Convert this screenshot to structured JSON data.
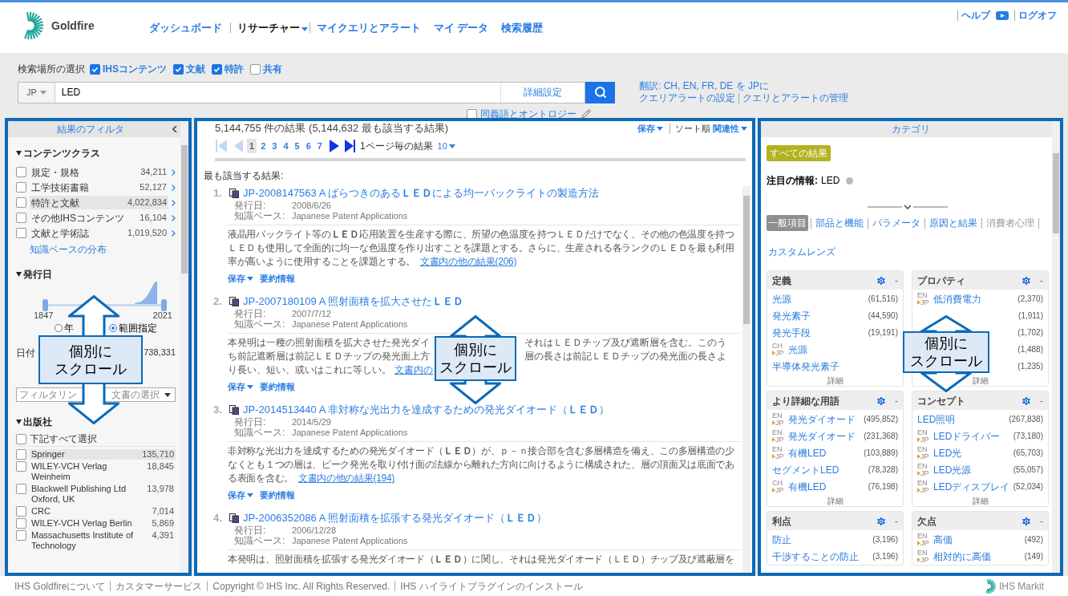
{
  "header": {
    "logo_text": "Goldfire",
    "nav": [
      {
        "label": "ダッシュボード",
        "selected": false,
        "menu": false
      },
      {
        "label": "リサーチャー",
        "selected": true,
        "menu": true
      },
      {
        "label": "マイクエリとアラート",
        "selected": false,
        "menu": false
      },
      {
        "label": "マイ データ",
        "selected": false,
        "menu": false
      },
      {
        "label": "検索履歴",
        "selected": false,
        "menu": false
      }
    ],
    "help": "ヘルプ",
    "logoff": "ログオフ"
  },
  "search": {
    "scope_label": "検索場所の選択",
    "scopes": [
      {
        "label": "IHSコンテンツ",
        "checked": true
      },
      {
        "label": "文献",
        "checked": true
      },
      {
        "label": "特許",
        "checked": true
      },
      {
        "label": "共有",
        "checked": false
      }
    ],
    "lang": "JP",
    "value": "LED",
    "advanced": "詳細設定",
    "synonyms": {
      "label": "同義語とオントロジー",
      "checked": false
    },
    "translate": "翻訳: CH, EN, FR, DE を JPに",
    "alert_setup": "クエリアラートの設定",
    "alert_manage": "クエリとアラートの管理"
  },
  "filters": {
    "title": "結果のフィルタ",
    "content_class": {
      "title": "コンテンツクラス",
      "items": [
        {
          "label": "規定・規格",
          "count": "34,211",
          "checked": false,
          "highlighted": false
        },
        {
          "label": "工学技術書籍",
          "count": "52,127",
          "checked": false,
          "highlighted": false
        },
        {
          "label": "特許と文献",
          "count": "4,022,834",
          "checked": false,
          "highlighted": true
        },
        {
          "label": "その他IHSコンテンツ",
          "count": "16,104",
          "checked": false,
          "highlighted": false
        },
        {
          "label": "文献と学術誌",
          "count": "1,019,520",
          "checked": false,
          "highlighted": false
        }
      ],
      "link": "知識ベースの分布"
    },
    "date": {
      "title": "発行日",
      "start": "1847",
      "end": "2021",
      "radios": [
        {
          "label": "年",
          "selected": false
        },
        {
          "label": "範囲指定",
          "selected": true
        }
      ],
      "date_label": "日付",
      "date_count": "738,331",
      "select_start": "フィルタリン",
      "select_end": "文書の選択"
    },
    "publishers": {
      "title": "出版社",
      "select_all": {
        "label": "下記すべて選択",
        "checked": false
      },
      "items": [
        {
          "label": "Springer",
          "count": "135,710",
          "checked": false,
          "highlighted": true
        },
        {
          "label": "WILEY-VCH Verlag Weinheim",
          "count": "18,845",
          "checked": false,
          "highlighted": false
        },
        {
          "label": "Blackwell Publishing Ltd Oxford, UK",
          "count": "13,978",
          "checked": false,
          "highlighted": false
        },
        {
          "label": "CRC",
          "count": "7,014",
          "checked": false,
          "highlighted": false
        },
        {
          "label": "WILEY-VCH Verlag Berlin",
          "count": "5,869",
          "checked": false,
          "highlighted": false
        },
        {
          "label": "Massachusetts Institute of Technology",
          "count": "4,391",
          "checked": false,
          "highlighted": false
        }
      ]
    }
  },
  "results": {
    "summary": "5,144,755 件の結果 (5,144,632 最も該当する結果)",
    "save": "保存",
    "sort_label": "ソート順",
    "sort_value": "関連性",
    "pages": [
      {
        "label": "1",
        "selected": true
      },
      {
        "label": "2",
        "selected": false
      },
      {
        "label": "3",
        "selected": false
      },
      {
        "label": "4",
        "selected": false
      },
      {
        "label": "5",
        "selected": false
      },
      {
        "label": "6",
        "selected": false
      },
      {
        "label": "7",
        "selected": false
      }
    ],
    "per_page_label": "1ページ毎の結果",
    "per_page": "10",
    "section": "最も該当する結果:",
    "items": [
      {
        "kind": "full",
        "num": "1.",
        "title": "JP-2008147563 A ばらつきのある**ＬＥＤ**による均一バックライトの製造方法",
        "date_label": "発行日:",
        "date": "2008/6/26",
        "kb_label": "知識ベース:",
        "kb": "Japanese Patent Applications",
        "abstract": "液晶用バックライト等の**ＬＥＤ**応用装置を生産する際に、所望の色温度を持つＬＥＤだけでなく、その他の色温度を持つＬＥＤも使用して全面的に均一な色温度を作り出すことを課題とする。さらに、生産される各ランクのＬＥＤを最も利用率が高いように使用することを課題とする。",
        "more": "文書内の他の結果(206)",
        "actions": [
          "保存",
          "要約情報"
        ]
      },
      {
        "kind": "split",
        "num": "2.",
        "title": "JP-2007180109 A 照射面積を拡大させた**ＬＥＤ**",
        "date_label": "発行日:",
        "date": "2007/7/12",
        "kb_label": "知識ベース:",
        "kb": "Japanese Patent Applications",
        "abstract_lines": [
          [
            "本発明は一種の照射面積を拡大させた発光ダイ",
            "それはＬＥＤチップ及び遮断層を含む。このう"
          ],
          [
            "ち前記遮断層は前記ＬＥＤチップの発光面上方",
            "層の長さは前記ＬＥＤチップの発光面の長さよ"
          ],
          [
            "り長い、短い、或いはこれに等しい。"
          ]
        ],
        "more": "文書内の",
        "actions": [
          "保存",
          "要約情報"
        ]
      },
      {
        "kind": "full",
        "num": "3.",
        "title": "JP-2014513440 A 非対称な光出力を達成するための発光ダイオード（**ＬＥＤ**）",
        "date_label": "発行日:",
        "date": "2014/5/29",
        "kb_label": "知識ベース:",
        "kb": "Japanese Patent Applications",
        "abstract": "非対称な光出力を達成するための発光ダイオード（**ＬＥＤ**）が、ｐ－ｎ接合部を含む多層構造を備え、この多層構造の少なくとも１つの層は、ピーク発光を取り付け面の法線から離れた方向に向けるように構成された、層の頂面又は底面である表面を含む。",
        "more": "文書内の他の結果(194)",
        "actions": [
          "保存",
          "要約情報"
        ]
      },
      {
        "kind": "full",
        "num": "4.",
        "title": "JP-2006352086 A 照射面積を拡張する発光ダイオード（**ＬＥＤ**）",
        "date_label": "発行日:",
        "date": "2006/12/28",
        "kb_label": "知識ベース:",
        "kb": "Japanese Patent Applications",
        "abstract": "本発明は、照射面積を拡張する発光ダイオード（**ＬＥＤ**）に関し、それは発光ダイオード（ＬＥＤ）チップ及び遮蔽層を"
      }
    ]
  },
  "categories": {
    "title": "カテゴリ",
    "all_results": "すべての結果",
    "focus_label": "注目の情報:",
    "focus_value": "LED",
    "tabs": [
      {
        "label": "一般項目",
        "selected": true,
        "disabled": false
      },
      {
        "label": "部品と機能",
        "selected": false,
        "disabled": false
      },
      {
        "label": "パラメータ",
        "selected": false,
        "disabled": false
      },
      {
        "label": "原因と結果",
        "selected": false,
        "disabled": false
      },
      {
        "label": "消費者心理",
        "selected": false,
        "disabled": true
      },
      {
        "label": "カスタムレンズ",
        "selected": false,
        "disabled": false
      }
    ],
    "cards": [
      {
        "title": "定義",
        "collapse": "-",
        "more": "詳細",
        "items": [
          {
            "label": "光源",
            "count": "(61,516)"
          },
          {
            "label": "発光素子",
            "count": "(44,590)"
          },
          {
            "label": "発光手段",
            "count": "(19,191)"
          },
          {
            "badge": [
              "CH",
              "JP"
            ],
            "label": "光源"
          },
          {
            "label": "半導体発光素子"
          }
        ]
      },
      {
        "title": "プロパティ",
        "collapse": "-",
        "more": "詳細",
        "items": [
          {
            "badge": [
              "EN",
              "JP"
            ],
            "label": "低消費電力",
            "count": "(2,370)"
          },
          {
            "count": "(1,911)"
          },
          {
            "count": "(1,702)"
          },
          {
            "count": "(1,488)"
          },
          {
            "count": "(1,235)"
          }
        ]
      },
      {
        "title": "より詳細な用語",
        "collapse": "-",
        "more": "詳細",
        "items": [
          {
            "badge": [
              "EN",
              "JP"
            ],
            "label": "発光ダイオード",
            "count": "(495,852)"
          },
          {
            "badge": [
              "EN",
              "JP"
            ],
            "label": "発光ダイオード",
            "count": "(231,368)"
          },
          {
            "badge": [
              "EN",
              "JP"
            ],
            "label": "有機LED",
            "count": "(103,889)"
          },
          {
            "label": "セグメントLED",
            "count": "(78,328)"
          },
          {
            "badge": [
              "CH",
              "JP"
            ],
            "label": "有機LED",
            "count": "(76,198)"
          }
        ]
      },
      {
        "title": "コンセプト",
        "collapse": "-",
        "more": "詳細",
        "items": [
          {
            "label": "LED照明",
            "count": "(267,838)"
          },
          {
            "badge": [
              "EN",
              "JP"
            ],
            "label": "LEDドライバー",
            "count": "(73,180)"
          },
          {
            "badge": [
              "EN",
              "JP"
            ],
            "label": "LED光",
            "count": "(65,703)"
          },
          {
            "badge": [
              "EN",
              "JP"
            ],
            "label": "LED光源",
            "count": "(55,057)"
          },
          {
            "badge": [
              "EN",
              "JP"
            ],
            "label": "LEDディスプレイ",
            "count": "(52,034)"
          }
        ]
      },
      {
        "title": "利点",
        "collapse": "-",
        "items": [
          {
            "label": "防止",
            "count": "(3,196)"
          },
          {
            "label": "干渉することの防止",
            "count": "(3,196)"
          }
        ]
      },
      {
        "title": "欠点",
        "collapse": "-",
        "items": [
          {
            "badge": [
              "EN",
              "JP"
            ],
            "label": "高価",
            "count": "(492)"
          },
          {
            "badge": [
              "EN",
              "JP"
            ],
            "label": "相対的に高価",
            "count": "(149)"
          }
        ]
      }
    ]
  },
  "callouts": [
    {
      "lines": [
        "個別に",
        "スクロール"
      ]
    },
    {
      "lines": [
        "個別に",
        "スクロール"
      ]
    },
    {
      "lines": [
        "個別に",
        "スクロール"
      ]
    }
  ],
  "footer": {
    "links": [
      "IHS Goldfireについて",
      "カスタマーサービス",
      "Copyright © IHS Inc. All Rights Reserved.",
      "IHS ハイライトプラグインのインストール"
    ],
    "brand": "IHS Markit"
  }
}
